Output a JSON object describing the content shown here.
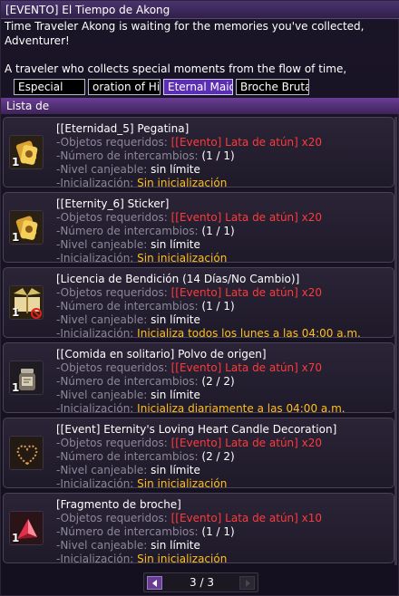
{
  "window": {
    "title": "[EVENTO] El Tiempo de Akong"
  },
  "description": {
    "line1": "Time Traveler Akong is waiting for the memories you've collected,",
    "line2": "Adventurer!",
    "line3": "",
    "line4": "A traveler who collects special moments from the flow of time,"
  },
  "tabs": [
    {
      "label": "Especial",
      "active": false
    },
    {
      "label": "oration of His",
      "active": false
    },
    {
      "label": "Eternal Maid",
      "active": true
    },
    {
      "label": "Broche Brutal",
      "active": false
    }
  ],
  "list_header": "Lista de",
  "labels": {
    "required": "-Objetos requeridos:",
    "exchanges": "-Número de intercambios:",
    "level": "-Nivel canjeable:",
    "reset": "-Inicialización:"
  },
  "items": [
    {
      "title": "[[Eternidad_5] Pegatina]",
      "required": "[[Evento] Lata de atún] x20",
      "exchanges": "(1 / 1)",
      "level": "sin límite",
      "reset": "Sin inicialización",
      "qty": "1",
      "icon": "golden-sticker-icon"
    },
    {
      "title": "[[Eternity_6] Sticker]",
      "required": "[[Evento] Lata de atún] x20",
      "exchanges": "(1 / 1)",
      "level": "sin límite",
      "reset": "Sin inicialización",
      "qty": "1",
      "icon": "golden-sticker-icon"
    },
    {
      "title": "[Licencia de Bendición (14 Días/No Cambio)]",
      "required": "[[Evento] Lata de atún] x20",
      "exchanges": "(1 / 1)",
      "level": "sin límite",
      "reset": "Inicializa todos los lunes a las 04:00 a.m.",
      "qty": "1",
      "icon": "blessing-book-icon"
    },
    {
      "title": "[[Comida en solitario] Polvo de origen]",
      "required": "[[Evento] Lata de atún] x70",
      "exchanges": "(2 / 2)",
      "level": "sin límite",
      "reset": "Inicializa diariamente a las 04:00 a.m.",
      "qty": "1",
      "icon": "powder-jar-icon"
    },
    {
      "title": "[[Event] Eternity's Loving Heart Candle Decoration]",
      "required": "[[Evento] Lata de atún] x20",
      "exchanges": "(2 / 2)",
      "level": "sin límite",
      "reset": "Sin inicialización",
      "qty": "",
      "icon": "heart-candle-icon"
    },
    {
      "title": "[Fragmento de broche]",
      "required": "[[Evento] Lata de atún] x10",
      "exchanges": "(1 / 1)",
      "level": "sin límite",
      "reset": "Sin inicialización",
      "qty": "1",
      "icon": "red-crystal-icon"
    }
  ],
  "pager": {
    "text": "3 / 3"
  },
  "colors": {
    "title_bar": "#4c3470",
    "active_tab": "#5b2fb3",
    "required_red": "#ff3a3a",
    "reset_yellow": "#ffbf1f"
  }
}
